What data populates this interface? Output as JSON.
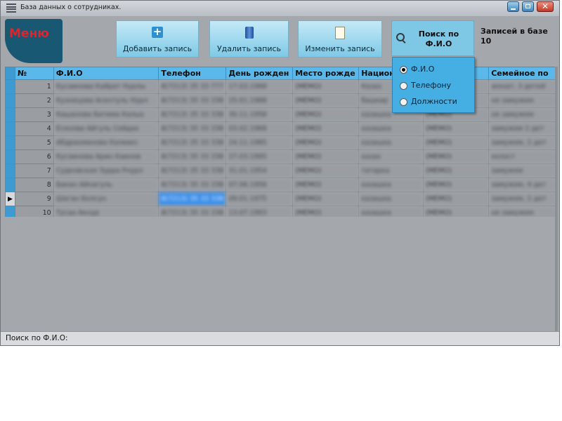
{
  "window": {
    "title": "База данных о сотрудниках."
  },
  "menu": {
    "label": "Меню"
  },
  "toolbar": {
    "add_label": "Добавить запись",
    "delete_label": "Удалить запись",
    "edit_label": "Изменить запись"
  },
  "search": {
    "title": "Поиск по Ф.И.О",
    "options": [
      {
        "label": "Ф.И.О",
        "selected": true
      },
      {
        "label": "Телефону",
        "selected": false
      },
      {
        "label": "Должности",
        "selected": false
      }
    ]
  },
  "records": {
    "label": "Записей в базе",
    "count": "10"
  },
  "grid": {
    "columns": [
      "№",
      "Ф.И.О",
      "Телефон",
      "День рожден",
      "Место рожде",
      "Национ",
      "...ки",
      "Семейное по"
    ],
    "rows": [
      {
        "num": "1",
        "fio": "Кусаинова Кайрат Нурлы",
        "phone": "8(7213) 35 33 777",
        "birthday": "17.03.1968",
        "place": "(MEMO)",
        "nation": "Казах",
        "extra": "",
        "family": "женат, 3 детей"
      },
      {
        "num": "2",
        "fio": "Кузнецова Асентуль Нурл",
        "phone": "8(7213) 35 33 338",
        "birthday": "25.01.1988",
        "place": "(MEMO)",
        "nation": "башкир",
        "extra": "",
        "family": "не замужем"
      },
      {
        "num": "3",
        "fio": "Кашанова Батима Калых",
        "phone": "8(7213) 35 33 338",
        "birthday": "30.11.1958",
        "place": "(MEMO)",
        "nation": "казашка",
        "extra": "(MEMO)",
        "family": "не замужем"
      },
      {
        "num": "4",
        "fio": "Есенова Айгуль Сейдах",
        "phone": "8(7213) 35 33 338",
        "birthday": "03.02.1968",
        "place": "(MEMO)",
        "nation": "казашка",
        "extra": "(MEMO)",
        "family": "замужем 2 дет"
      },
      {
        "num": "5",
        "fio": "Абдрахманова Калиакс",
        "phone": "8(7213) 35 33 338",
        "birthday": "24.11.1985",
        "place": "(MEMO)",
        "nation": "казашка",
        "extra": "(MEMO)",
        "family": "замужем, 2 дет"
      },
      {
        "num": "6",
        "fio": "Кусаинова Арин Каинов",
        "phone": "8(7213) 35 33 338",
        "birthday": "27.03.1995",
        "place": "(MEMO)",
        "nation": "казах",
        "extra": "(MEMO)",
        "family": "холост"
      },
      {
        "num": "7",
        "fio": "Судковская Зурра Рнурл",
        "phone": "8(7213) 35 33 338",
        "birthday": "31.01.1954",
        "place": "(MEMO)",
        "nation": "татарка",
        "extra": "(MEMO)",
        "family": "замужем"
      },
      {
        "num": "8",
        "fio": "Бакан Айнагуль",
        "phone": "8(7213) 35 33 338",
        "birthday": "07.06.1956",
        "place": "(MEMO)",
        "nation": "казашка",
        "extra": "(MEMO)",
        "family": "замужем, 4 дет"
      },
      {
        "num": "9",
        "fio": "Шаган Болсун",
        "phone": "8(7213) 35 33 338",
        "birthday": "09.01.1975",
        "place": "(MEMO)",
        "nation": "казашка",
        "extra": "(MEMO)",
        "family": "замужем, 2 дет"
      },
      {
        "num": "10",
        "fio": "Тусаа Акнур",
        "phone": "8(7213) 35 33 338",
        "birthday": "13.07.1993",
        "place": "(MEMO)",
        "nation": "казашка",
        "extra": "(MEMO)",
        "family": "не замужем"
      }
    ]
  },
  "status": {
    "text": "Поиск по Ф.И.О:"
  },
  "colors": {
    "accent": "#5ab8ea",
    "menu_text": "#e2232a",
    "menu_bg": "#185872",
    "window_bg": "#a4a8ac"
  }
}
